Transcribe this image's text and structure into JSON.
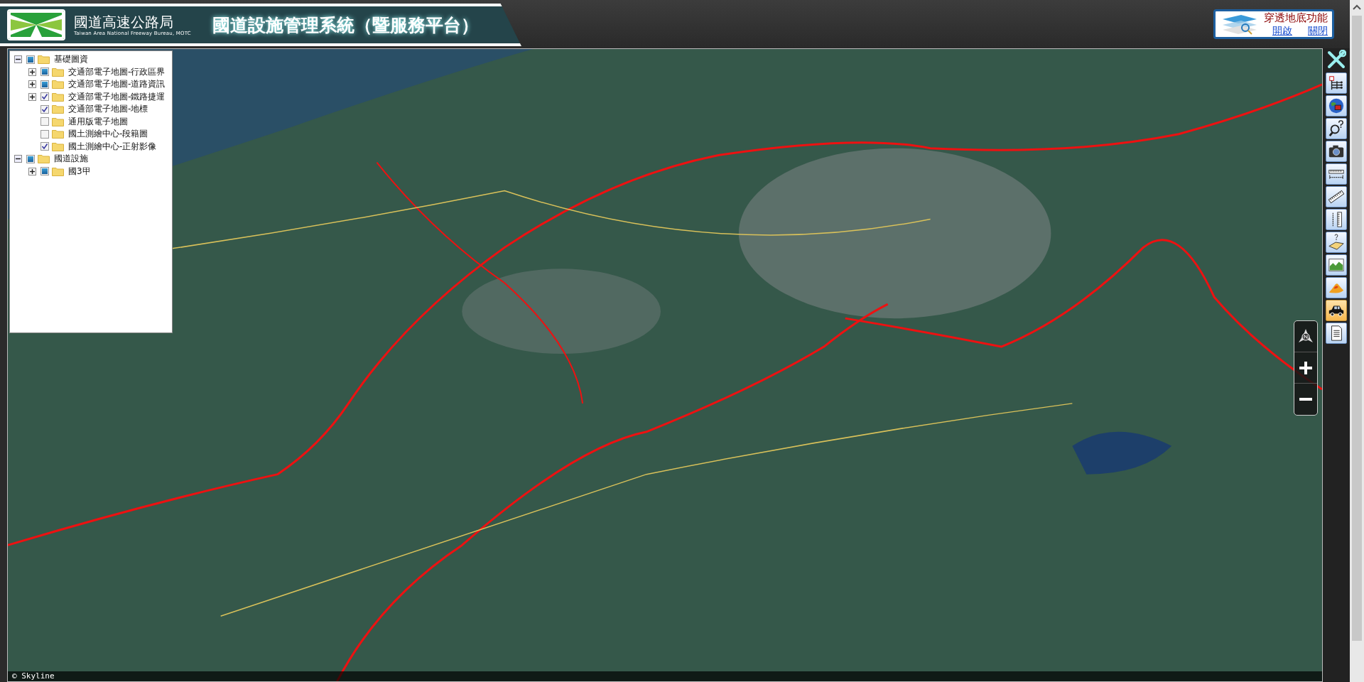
{
  "header": {
    "agency_name": "國道高速公路局",
    "agency_name_en": "Taiwan Area National Freeway Bureau, MOTC",
    "system_title": "國道設施管理系統（暨服務平台）"
  },
  "underground_panel": {
    "title": "穿透地底功能",
    "links": [
      {
        "label": "開啟"
      },
      {
        "label": "關閉"
      }
    ]
  },
  "layer_tree": {
    "items": [
      {
        "label": "基礎圖資",
        "kind": "branch",
        "expanded": true,
        "checkbox": {
          "kind": "partial"
        },
        "children": [
          {
            "label": "交通部電子地圖-行政區界",
            "kind": "branch",
            "expanded": false,
            "checkbox": {
              "kind": "partial"
            }
          },
          {
            "label": "交通部電子地圖-道路資訊",
            "kind": "branch",
            "expanded": false,
            "checkbox": {
              "kind": "partial"
            }
          },
          {
            "label": "交通部電子地圖-鐵路捷運",
            "kind": "branch",
            "expanded": false,
            "checkbox": {
              "kind": "ticked"
            }
          },
          {
            "label": "交通部電子地圖-地標",
            "kind": "leaf",
            "checkbox": {
              "kind": "ticked"
            }
          },
          {
            "label": "通用版電子地圖",
            "kind": "leaf",
            "checkbox": {
              "kind": "empty"
            }
          },
          {
            "label": "國土測繪中心-段籍圖",
            "kind": "leaf",
            "checkbox": {
              "kind": "empty"
            }
          },
          {
            "label": "國土測繪中心-正射影像",
            "kind": "leaf",
            "checkbox": {
              "kind": "ticked"
            }
          }
        ]
      },
      {
        "label": "國道設施",
        "kind": "branch",
        "expanded": true,
        "checkbox": {
          "kind": "partial"
        },
        "children": [
          {
            "label": "國3甲",
            "kind": "branch",
            "expanded": false,
            "checkbox": {
              "kind": "partial"
            }
          }
        ]
      }
    ]
  },
  "toolbar": {
    "tools": [
      {
        "kind": "layers",
        "selected": false
      },
      {
        "kind": "globe",
        "selected": false
      },
      {
        "kind": "query",
        "selected": false
      },
      {
        "kind": "camera",
        "selected": false
      },
      {
        "kind": "ruler",
        "selected": false
      },
      {
        "kind": "diagonal-ruler",
        "selected": false
      },
      {
        "kind": "vertical-ruler",
        "selected": false
      },
      {
        "kind": "area",
        "selected": false
      },
      {
        "kind": "profile",
        "selected": false
      },
      {
        "kind": "terrain",
        "selected": false
      },
      {
        "kind": "car",
        "selected": true
      },
      {
        "kind": "document",
        "selected": false
      }
    ]
  },
  "map": {
    "copyright": "© Skyline"
  }
}
